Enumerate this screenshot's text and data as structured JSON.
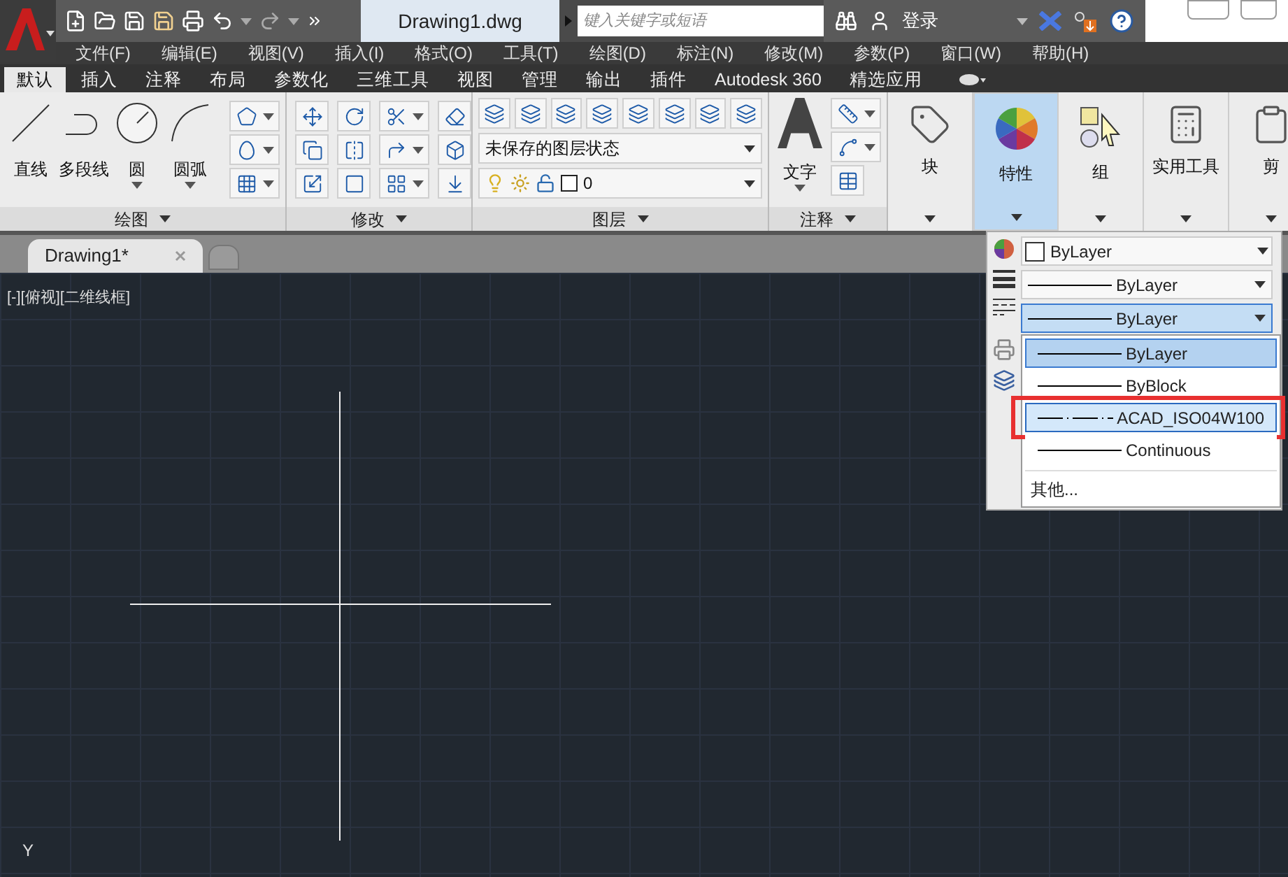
{
  "title": "Drawing1.dwg",
  "search": {
    "placeholder": "键入关键字或短语"
  },
  "user": {
    "label": "登录"
  },
  "menu_bar": [
    "文件(F)",
    "编辑(E)",
    "视图(V)",
    "插入(I)",
    "格式(O)",
    "工具(T)",
    "绘图(D)",
    "标注(N)",
    "修改(M)",
    "参数(P)",
    "窗口(W)",
    "帮助(H)"
  ],
  "ribbon_tabs": [
    {
      "label": "默认",
      "selected": true
    },
    {
      "label": "插入",
      "selected": false
    },
    {
      "label": "注释",
      "selected": false
    },
    {
      "label": "布局",
      "selected": false
    },
    {
      "label": "参数化",
      "selected": false
    },
    {
      "label": "三维工具",
      "selected": false
    },
    {
      "label": "视图",
      "selected": false
    },
    {
      "label": "管理",
      "selected": false
    },
    {
      "label": "输出",
      "selected": false
    },
    {
      "label": "插件",
      "selected": false
    },
    {
      "label": "Autodesk 360",
      "selected": false
    },
    {
      "label": "精选应用",
      "selected": false
    }
  ],
  "draw_panel": {
    "title": "绘图",
    "tools": [
      "直线",
      "多段线",
      "圆",
      "圆弧"
    ]
  },
  "modify_panel": {
    "title": "修改"
  },
  "layers_panel": {
    "title": "图层",
    "layer_state": "未保存的图层状态",
    "layer": "0"
  },
  "annotation_panel": {
    "title": "注释",
    "tool": "文字"
  },
  "large_panels": [
    {
      "label": "块",
      "selected": false
    },
    {
      "label": "特性",
      "selected": true
    },
    {
      "label": "组",
      "selected": false
    },
    {
      "label": "实用工具",
      "selected": false
    },
    {
      "label": "剪",
      "selected": false
    }
  ],
  "properties_popup": {
    "color_setting": "ByLayer",
    "lineweight": "ByLayer",
    "linetype": "ByLayer",
    "linetype_options": [
      {
        "label": "ByLayer",
        "selected": true,
        "hovered": false,
        "highlighted_in_red": false,
        "kind": "solid"
      },
      {
        "label": "ByBlock",
        "selected": false,
        "hovered": false,
        "highlighted_in_red": false,
        "kind": "solid"
      },
      {
        "label": "ACAD_ISO04W100",
        "selected": false,
        "hovered": true,
        "highlighted_in_red": true,
        "kind": "dashdot"
      },
      {
        "label": "Continuous",
        "selected": false,
        "hovered": false,
        "highlighted_in_red": false,
        "kind": "solid"
      }
    ],
    "other": "其他..."
  },
  "document_tabs": [
    {
      "label": "Drawing1*",
      "selected": true
    }
  ],
  "viewport_label": "[-][俯视][二维线框]",
  "ucs_axis": "Y"
}
